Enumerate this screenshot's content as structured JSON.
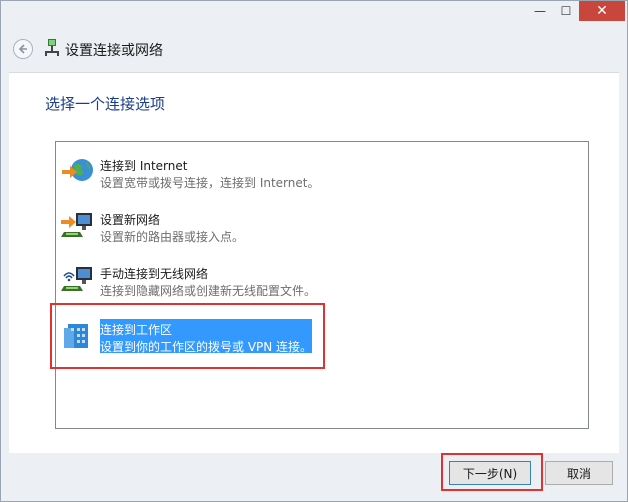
{
  "window": {
    "controls": {
      "minimize": "—",
      "maximize": "☐",
      "close": "✕"
    }
  },
  "nav": {
    "back_icon": "back-arrow-icon",
    "title": "设置连接或网络"
  },
  "content": {
    "heading": "选择一个连接选项",
    "options": [
      {
        "title": "连接到 Internet",
        "desc": "设置宽带或拨号连接，连接到 Internet。",
        "icon": "globe-network-icon"
      },
      {
        "title": "设置新网络",
        "desc": "设置新的路由器或接入点。",
        "icon": "new-network-icon"
      },
      {
        "title": "手动连接到无线网络",
        "desc": "连接到隐藏网络或创建新无线配置文件。",
        "icon": "wireless-network-icon"
      },
      {
        "title": "连接到工作区",
        "desc": "设置到你的工作区的拨号或 VPN 连接。",
        "icon": "workplace-icon",
        "selected": true
      }
    ]
  },
  "footer": {
    "next_label": "下一步(N)",
    "cancel_label": "取消"
  },
  "colors": {
    "selection": "#3399ff",
    "highlight_box": "#e03232",
    "heading": "#1a3e8c"
  }
}
